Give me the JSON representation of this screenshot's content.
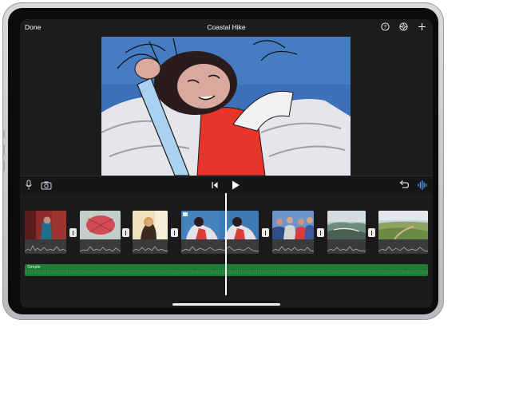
{
  "topbar": {
    "done_label": "Done",
    "title": "Coastal Hike",
    "icons": [
      "help-icon",
      "settings-icon",
      "add-icon"
    ]
  },
  "controls": {
    "icons": [
      "microphone-icon",
      "camera-icon",
      "skip-to-start-icon",
      "play-icon",
      "undo-icon",
      "audio-waveform-icon"
    ]
  },
  "timeline": {
    "clips": [
      {
        "name": "clip-1",
        "colors": [
          "#7a2a2a",
          "#1e5c74"
        ]
      },
      {
        "name": "clip-2",
        "colors": [
          "#b8c6c0",
          "#c94a55"
        ]
      },
      {
        "name": "clip-3",
        "colors": [
          "#d69a4c",
          "#f0e2b8"
        ]
      },
      {
        "name": "clip-4",
        "colors": [
          "#3c79b8",
          "#d9403a"
        ]
      },
      {
        "name": "clip-5",
        "colors": [
          "#3a5c9a",
          "#d8d6d3"
        ]
      },
      {
        "name": "clip-6",
        "colors": [
          "#8aa3b0",
          "#4d5f55"
        ]
      },
      {
        "name": "clip-7",
        "colors": [
          "#7a9a53",
          "#b7c7a9"
        ]
      }
    ],
    "music_label": "Simple"
  },
  "colors": {
    "accent": "#5aa9ff",
    "music_track": "#1f7a36",
    "background": "#1c1c1e"
  }
}
